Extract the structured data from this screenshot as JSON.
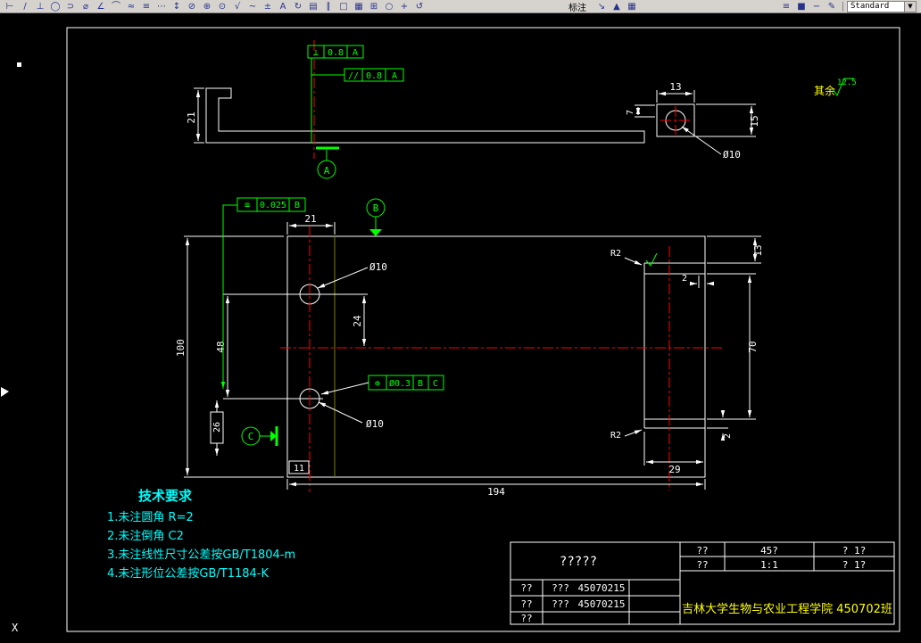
{
  "colors": {
    "line": "#ffffff",
    "tolerance_green": "#00ff00",
    "centerline_red": "#ff0000",
    "tech_note_cyan": "#00ffff",
    "title_yellow": "#ffff00",
    "edge_olive": "#808000",
    "toolbar_gray": "#d6d3ce"
  },
  "toolbar": {
    "dim_label": "标注",
    "style_value": "Standard",
    "dropdown_arrow": "▼",
    "left_icons": [
      {
        "n": "dim-linear-icon",
        "g": "⊢"
      },
      {
        "n": "dim-aligned-icon",
        "g": "∕"
      },
      {
        "n": "dim-ordinate-icon",
        "g": "⊥"
      },
      {
        "n": "dim-radius-icon",
        "g": "◯"
      },
      {
        "n": "dim-jogged-icon",
        "g": "⊃"
      },
      {
        "n": "dim-diameter-icon",
        "g": "⌀"
      },
      {
        "n": "dim-angular-icon",
        "g": "∠"
      },
      {
        "n": "dim-arc-length-icon",
        "g": "⌒"
      },
      {
        "n": "quick-dim-icon",
        "g": "≈"
      },
      {
        "n": "dim-baseline-icon",
        "g": "≡"
      },
      {
        "n": "dim-continue-icon",
        "g": "⋯"
      },
      {
        "n": "dim-space-icon",
        "g": "↕"
      },
      {
        "n": "dim-break-icon",
        "g": "⊘"
      },
      {
        "n": "tolerance-icon",
        "g": "⊕"
      },
      {
        "n": "center-mark-icon",
        "g": "⊙"
      },
      {
        "n": "inspection-icon",
        "g": "√"
      },
      {
        "n": "jogged-linear-icon",
        "g": "~"
      },
      {
        "n": "dim-edit-icon",
        "g": "±"
      },
      {
        "n": "dim-text-edit-icon",
        "g": "A"
      },
      {
        "n": "dim-update-icon",
        "g": "↻"
      },
      {
        "n": "dim-style-icon",
        "g": "▤"
      },
      {
        "n": "ortho-icon",
        "g": "∥"
      },
      {
        "n": "osnap-icon",
        "g": "□"
      },
      {
        "n": "grid-icon",
        "g": "▦"
      },
      {
        "n": "zoom-window-icon",
        "g": "⊞"
      },
      {
        "n": "zoom-realtime-icon",
        "g": "○"
      },
      {
        "n": "pan-icon",
        "g": "+"
      },
      {
        "n": "redraw-icon",
        "g": "↺"
      }
    ],
    "mid_icons": [
      {
        "n": "leader-icon",
        "g": "↘"
      },
      {
        "n": "datum-identifier-icon",
        "g": "▲"
      },
      {
        "n": "table-icon",
        "g": "▦"
      }
    ],
    "right_icons": [
      {
        "n": "layers-icon",
        "g": "≡"
      },
      {
        "n": "layer-color-icon",
        "g": "■"
      },
      {
        "n": "linetype-icon",
        "g": "−"
      },
      {
        "n": "text-edit-icon",
        "g": "✎"
      }
    ]
  },
  "drawing": {
    "top_view": {
      "dim_left": "21",
      "dim_top": "13",
      "dim_side": "7",
      "dim_right": "15",
      "hole_dia": "Ø10"
    },
    "front_view": {
      "dim_width_top": "21",
      "dim_height": "100",
      "dim_hole_spacing": "48",
      "dim_bottom_offset": "26",
      "dim_hole_to_center": "24",
      "hole_dia_top": "Ø10",
      "hole_dia_bottom": "Ø10",
      "dim_length": "194",
      "dim_flange_height": "70",
      "dim_lip": "13",
      "dim_thickness_top": "2",
      "dim_thickness_bottom": "2",
      "dim_flange_width": "29",
      "fillet_top": "R2",
      "fillet_bottom": "R2",
      "dim_ref": "11"
    },
    "fcf": {
      "perpendicularity": {
        "symbol": "⊥",
        "value": "0.8",
        "datum": "A"
      },
      "parallelism": {
        "symbol": "//",
        "value": "0.8",
        "datum": "A"
      },
      "symmetry": {
        "symbol": "≡",
        "value": "0.025",
        "datum": "B"
      },
      "position": {
        "symbol": "⊕",
        "value": "Ø0.3",
        "datum1": "B",
        "datum2": "C"
      }
    },
    "datums": {
      "a": "A",
      "b": "B",
      "c": "C"
    },
    "surface_finish": {
      "label": "其余",
      "value": "12.5"
    }
  },
  "tech_requirements": {
    "title": "技术要求",
    "items": [
      "1.未注圆角 R=2",
      "2.未注倒角 C2",
      "3.未注线性尺寸公差按GB/T1804-m",
      "4.未注形位公差按GB/T1184-K"
    ]
  },
  "title_block": {
    "part_name": "?????",
    "rows": [
      {
        "label": "??",
        "doc": "???",
        "number": "45070215"
      },
      {
        "label": "??",
        "doc": "???",
        "number": "45070215"
      },
      {
        "label": "??",
        "doc": "",
        "number": ""
      }
    ],
    "right": {
      "r1_label": "??",
      "r1_val": "45?",
      "r1_extra": "? 1?",
      "r2_label": "??",
      "r2_val": "1:1",
      "r2_extra": "? 1?"
    },
    "org": "吉林大学生物与农业工程学院  450702班"
  },
  "ucs": {
    "x_label": "X"
  }
}
